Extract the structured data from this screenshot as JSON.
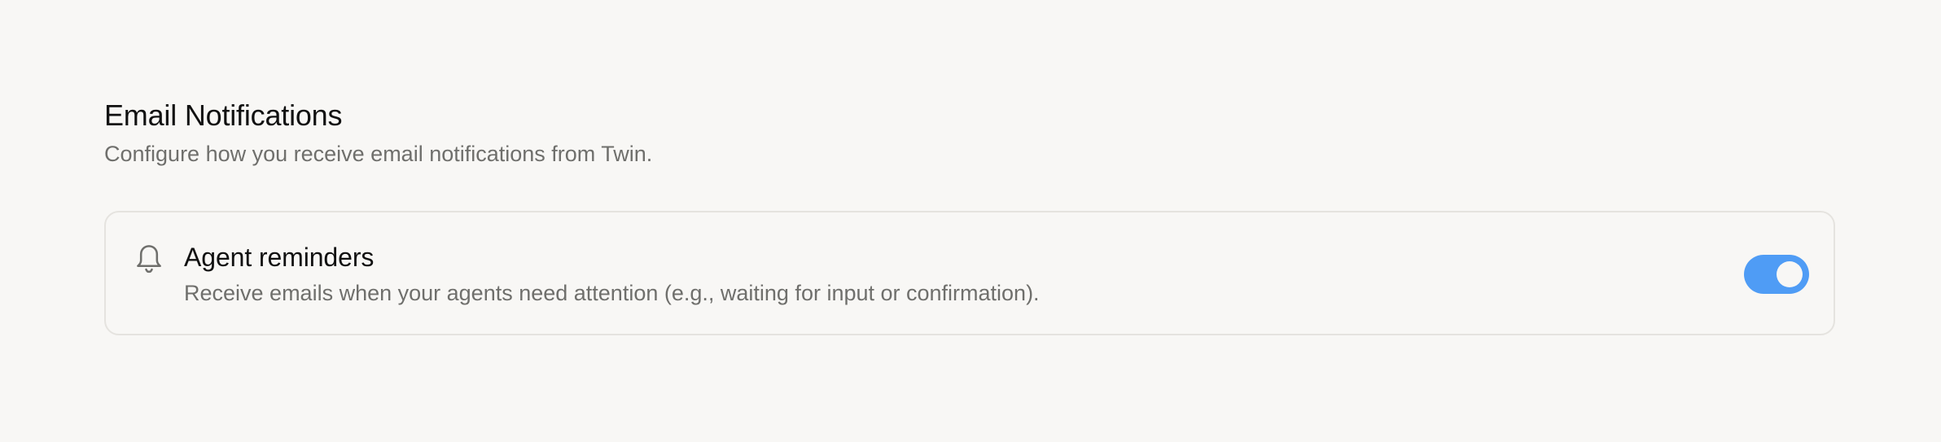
{
  "section": {
    "title": "Email Notifications",
    "description": "Configure how you receive email notifications from Twin."
  },
  "agent_reminders": {
    "icon": "bell-icon",
    "title": "Agent reminders",
    "description": "Receive emails when your agents need attention (e.g., waiting for input or confirmation).",
    "enabled": true
  },
  "colors": {
    "background": "#f8f7f5",
    "toggle_on": "#4f9cf5",
    "card_border": "#e5e3df",
    "title_text": "#111111",
    "muted_text": "#6f6f6c"
  }
}
